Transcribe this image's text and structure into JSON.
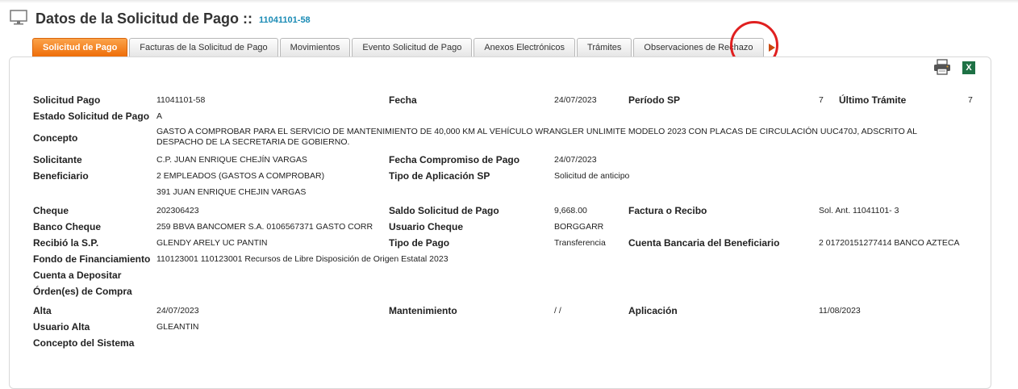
{
  "header": {
    "title": "Datos de la Solicitud de Pago ::",
    "id": "11041101-58"
  },
  "tabs": [
    {
      "label": "Solicitud de Pago",
      "active": true
    },
    {
      "label": "Facturas de la Solicitud de Pago",
      "active": false
    },
    {
      "label": "Movimientos",
      "active": false
    },
    {
      "label": "Evento Solicitud de Pago",
      "active": false
    },
    {
      "label": "Anexos Electrónicos",
      "active": false
    },
    {
      "label": "Trámites",
      "active": false
    },
    {
      "label": "Observaciones de Rechazo",
      "active": false
    }
  ],
  "toolbar": {
    "excel_label": "X"
  },
  "colors": {
    "accent": "#f28a2e",
    "link": "#1a8bb5",
    "annotation": "#e02020"
  },
  "fields": {
    "solicitud_pago": {
      "label": "Solicitud Pago",
      "value": "11041101-58"
    },
    "fecha": {
      "label": "Fecha",
      "value": "24/07/2023"
    },
    "periodo_sp": {
      "label": "Período SP",
      "value": "7"
    },
    "ultimo_tramite": {
      "label": "Último Trámite",
      "value": "7"
    },
    "estado": {
      "label": "Estado Solicitud de Pago",
      "value": "A"
    },
    "concepto": {
      "label": "Concepto",
      "value": "GASTO A COMPROBAR PARA EL SERVICIO DE MANTENIMIENTO DE 40,000 KM AL VEHÍCULO WRANGLER UNLIMITE MODELO 2023 CON PLACAS DE CIRCULACIÓN UUC470J, ADSCRITO AL DESPACHO DE LA SECRETARIA DE GOBIERNO."
    },
    "solicitante": {
      "label": "Solicitante",
      "value": "C.P. JUAN ENRIQUE CHEJÍN VARGAS"
    },
    "fecha_compromiso": {
      "label": "Fecha Compromiso de Pago",
      "value": "24/07/2023"
    },
    "beneficiario": {
      "label": "Beneficiario",
      "value": "2 EMPLEADOS (GASTOS A COMPROBAR)",
      "value2": "391 JUAN ENRIQUE CHEJIN VARGAS"
    },
    "tipo_aplicacion": {
      "label": "Tipo de Aplicación SP",
      "value": "Solicitud de anticipo"
    },
    "cheque": {
      "label": "Cheque",
      "value": "202306423"
    },
    "saldo": {
      "label": "Saldo Solicitud de Pago",
      "value": "9,668.00"
    },
    "factura": {
      "label": "Factura o Recibo",
      "value": "Sol. Ant. 11041101- 3"
    },
    "banco_cheque": {
      "label": "Banco Cheque",
      "value": "259 BBVA BANCOMER S.A. 0106567371 GASTO CORR"
    },
    "usuario_cheque": {
      "label": "Usuario Cheque",
      "value": "BORGGARR"
    },
    "recibio": {
      "label": "Recibió la S.P.",
      "value": "GLENDY ARELY UC PANTIN"
    },
    "tipo_pago": {
      "label": "Tipo de Pago",
      "value": "Transferencia"
    },
    "cuenta_beneficiario": {
      "label": "Cuenta Bancaria del Beneficiario",
      "value": "2  01720151277414 BANCO AZTECA"
    },
    "fondo": {
      "label": "Fondo de Financiamiento",
      "value": "110123001 110123001 Recursos de Libre Disposición de Origen Estatal 2023"
    },
    "cuenta_depositar": {
      "label": "Cuenta a Depositar"
    },
    "ordenes": {
      "label": "Órden(es) de Compra"
    },
    "alta": {
      "label": "Alta",
      "value": "24/07/2023"
    },
    "mantenimiento": {
      "label": "Mantenimiento",
      "value": "/ /"
    },
    "aplicacion": {
      "label": "Aplicación",
      "value": "11/08/2023"
    },
    "usuario_alta": {
      "label": "Usuario Alta",
      "value": "GLEANTIN"
    },
    "concepto_sistema": {
      "label": "Concepto del Sistema"
    }
  }
}
